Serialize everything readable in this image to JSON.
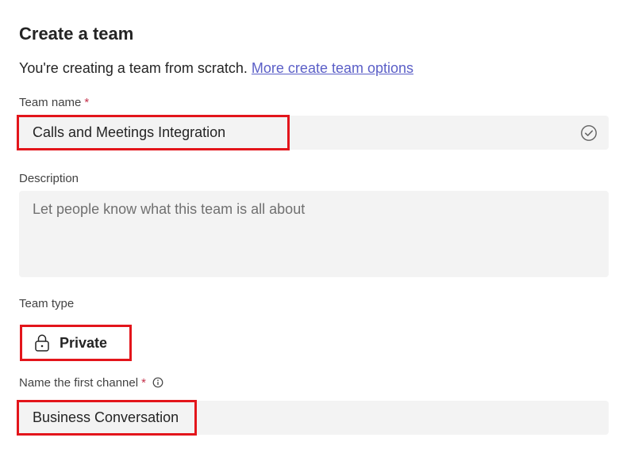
{
  "header": {
    "title": "Create a team",
    "intro_text": "You're creating a team from scratch.",
    "more_options_link": "More create team options"
  },
  "team_name": {
    "label": "Team name",
    "required_mark": "*",
    "value": "Calls and Meetings Integration",
    "status_icon": "check-circle-icon"
  },
  "description": {
    "label": "Description",
    "placeholder": "Let people know what this team is all about",
    "value": ""
  },
  "team_type": {
    "label": "Team type",
    "selected": "Private",
    "icon": "lock-icon"
  },
  "first_channel": {
    "label": "Name the first channel",
    "required_mark": "*",
    "info_icon": "info-icon",
    "value": "Business Conversation"
  },
  "colors": {
    "accent_link": "#5b5fc7",
    "required": "#c4314b",
    "highlight_box": "#e3151b",
    "field_bg": "#f3f3f3"
  }
}
